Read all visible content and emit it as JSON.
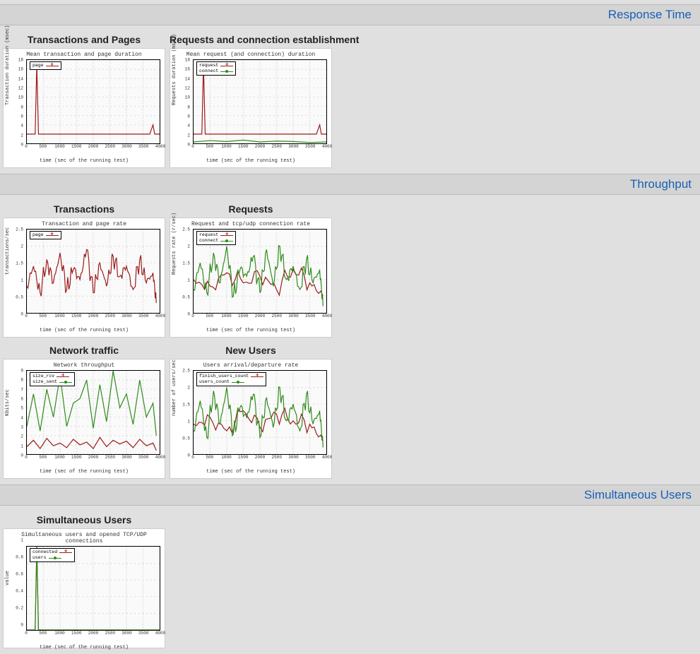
{
  "sections": {
    "response_time": "Response Time",
    "throughput": "Throughput",
    "simultaneous": "Simultaneous Users"
  },
  "xlabel_common": "time (sec of the running test)",
  "xticks": [
    "0",
    "500",
    "1000",
    "1500",
    "2000",
    "2500",
    "3000",
    "3500",
    "4000"
  ],
  "charts": {
    "txn_pages": {
      "title": "Transactions and Pages",
      "subtitle": "Mean transaction and page duration",
      "ylabel": "Transaction duration (msec)",
      "legend": [
        {
          "name": "page",
          "color": "red",
          "marker": "cross"
        }
      ],
      "ylim": [
        0,
        18
      ],
      "yticks": [
        "0",
        "2",
        "4",
        "6",
        "8",
        "10",
        "12",
        "14",
        "16",
        "18"
      ]
    },
    "req_conn": {
      "title": "Requests and connection establishment",
      "subtitle": "Mean request (and connection) duration",
      "ylabel": "Requests duration (msec)",
      "legend": [
        {
          "name": "request",
          "color": "red",
          "marker": "cross"
        },
        {
          "name": "connect",
          "color": "green",
          "marker": "dot"
        }
      ],
      "ylim": [
        0,
        18
      ],
      "yticks": [
        "0",
        "2",
        "4",
        "6",
        "8",
        "10",
        "12",
        "14",
        "16",
        "18"
      ]
    },
    "txn_rate": {
      "title": "Transactions",
      "subtitle": "Transaction and page rate",
      "ylabel": "transactions/sec",
      "legend": [
        {
          "name": "page",
          "color": "red",
          "marker": "cross"
        }
      ],
      "ylim": [
        0,
        2.5
      ],
      "yticks": [
        "0",
        "0.5",
        "1",
        "1.5",
        "2",
        "2.5"
      ]
    },
    "req_rate": {
      "title": "Requests",
      "subtitle": "Request and tcp/udp connection rate",
      "ylabel": "Requests rate (r/sec)",
      "legend": [
        {
          "name": "request",
          "color": "red",
          "marker": "cross"
        },
        {
          "name": "connect",
          "color": "green",
          "marker": "dot"
        }
      ],
      "ylim": [
        0,
        2.5
      ],
      "yticks": [
        "0",
        "0.5",
        "1",
        "1.5",
        "2",
        "2.5"
      ]
    },
    "network": {
      "title": "Network traffic",
      "subtitle": "Network throughput",
      "ylabel": "Kbits/sec",
      "legend": [
        {
          "name": "size_rcv",
          "color": "red",
          "marker": "cross"
        },
        {
          "name": "size_sent",
          "color": "green",
          "marker": "dot"
        }
      ],
      "ylim": [
        0,
        9
      ],
      "yticks": [
        "0",
        "1",
        "2",
        "3",
        "4",
        "5",
        "6",
        "7",
        "8",
        "9"
      ]
    },
    "new_users": {
      "title": "New Users",
      "subtitle": "Users arrival/departure rate",
      "ylabel": "number of users/sec",
      "legend": [
        {
          "name": "finish_users_count",
          "color": "red",
          "marker": "cross"
        },
        {
          "name": "users_count",
          "color": "green",
          "marker": "dot"
        }
      ],
      "ylim": [
        0,
        2.5
      ],
      "yticks": [
        "0",
        "0.5",
        "1",
        "1.5",
        "2",
        "2.5"
      ]
    },
    "sim_users": {
      "title": "Simultaneous Users",
      "subtitle": "Simultaneous users and opened TCP/UDP connections",
      "ylabel": "value",
      "legend": [
        {
          "name": "connected",
          "color": "red",
          "marker": "cross"
        },
        {
          "name": "users",
          "color": "green",
          "marker": "dot"
        }
      ],
      "ylim": [
        0,
        1
      ],
      "yticks": [
        "0",
        "0.2",
        "0.4",
        "0.6",
        "0.8",
        "1"
      ]
    }
  },
  "chart_data": [
    {
      "id": "txn_pages",
      "type": "line",
      "xlabel": "time (sec of the running test)",
      "ylabel": "Transaction duration (msec)",
      "title": "Mean transaction and page duration",
      "xlim": [
        0,
        4000
      ],
      "ylim": [
        0,
        18
      ],
      "series": [
        {
          "name": "page",
          "color": "#9c1b1b",
          "approx": "nearly flat around 2 with spike to ~17 near x≈300 and small bump to ~4 near x≈3800",
          "x": [
            0,
            250,
            300,
            350,
            1000,
            2000,
            2500,
            3000,
            3500,
            3700,
            3800,
            3850,
            4000
          ],
          "y": [
            2,
            2,
            17,
            2,
            2,
            2,
            2,
            2,
            2,
            2,
            4,
            2,
            2
          ]
        }
      ]
    },
    {
      "id": "req_conn",
      "type": "line",
      "xlabel": "time (sec of the running test)",
      "ylabel": "Requests duration (msec)",
      "title": "Mean request (and connection) duration",
      "xlim": [
        0,
        4000
      ],
      "ylim": [
        0,
        18
      ],
      "series": [
        {
          "name": "request",
          "color": "#9c1b1b",
          "approx": "~2 baseline, spike to ~17 at x≈300, bump to ~4 at x≈3800",
          "x": [
            0,
            250,
            300,
            350,
            1000,
            2000,
            3000,
            3700,
            3800,
            3850,
            4000
          ],
          "y": [
            2,
            2,
            17,
            2,
            2,
            2,
            2,
            2,
            4,
            2,
            2
          ]
        },
        {
          "name": "connect",
          "color": "#2e8b1a",
          "approx": "low noisy baseline ~0–1",
          "x": [
            0,
            500,
            1000,
            1500,
            2000,
            2500,
            3000,
            3500,
            4000
          ],
          "y": [
            0.3,
            0.6,
            0.4,
            0.7,
            0.3,
            0.5,
            0.4,
            0.2,
            0.3
          ]
        }
      ]
    },
    {
      "id": "txn_rate",
      "type": "line",
      "xlabel": "time (sec of the running test)",
      "ylabel": "transactions/sec",
      "title": "Transaction and page rate",
      "xlim": [
        0,
        4000
      ],
      "ylim": [
        0,
        2.5
      ],
      "series": [
        {
          "name": "page",
          "color": "#9c1b1b",
          "approx": "dense noise oscillating roughly 0.5–1.5 with occasional peaks near 2",
          "x": [
            0,
            200,
            400,
            600,
            800,
            1000,
            1200,
            1400,
            1600,
            1800,
            2000,
            2200,
            2400,
            2600,
            2800,
            3000,
            3200,
            3400,
            3600,
            3800,
            3900
          ],
          "y": [
            0.8,
            1.4,
            0.6,
            1.6,
            0.9,
            1.8,
            0.7,
            1.3,
            1.0,
            1.9,
            0.6,
            1.5,
            0.8,
            1.7,
            1.1,
            1.4,
            0.7,
            1.6,
            0.9,
            1.2,
            0.3
          ]
        }
      ]
    },
    {
      "id": "req_rate",
      "type": "line",
      "xlabel": "time (sec of the running test)",
      "ylabel": "Requests rate (r/sec)",
      "title": "Request and tcp/udp connection rate",
      "xlim": [
        0,
        4000
      ],
      "ylim": [
        0,
        2.5
      ],
      "series": [
        {
          "name": "request",
          "color": "#9c1b1b",
          "approx": "mostly hidden behind connect, noise 0.5–1.5",
          "x": [
            0,
            500,
            1000,
            1500,
            2000,
            2500,
            3000,
            3500,
            3900
          ],
          "y": [
            1.0,
            0.8,
            1.2,
            0.9,
            1.1,
            0.7,
            1.3,
            0.9,
            0.5
          ]
        },
        {
          "name": "connect",
          "color": "#2e8b1a",
          "approx": "dense green noise 0.3–2.0",
          "x": [
            0,
            200,
            400,
            600,
            800,
            1000,
            1200,
            1400,
            1600,
            1800,
            2000,
            2200,
            2400,
            2600,
            2800,
            3000,
            3200,
            3400,
            3600,
            3800,
            3900
          ],
          "y": [
            0.7,
            1.5,
            0.6,
            1.8,
            0.9,
            2.0,
            0.5,
            1.3,
            1.1,
            1.7,
            0.6,
            1.9,
            0.8,
            2.0,
            1.0,
            1.4,
            0.7,
            1.6,
            0.9,
            1.3,
            0.2
          ]
        }
      ]
    },
    {
      "id": "network",
      "type": "line",
      "xlabel": "time (sec of the running test)",
      "ylabel": "Kbits/sec",
      "title": "Network throughput",
      "xlim": [
        0,
        4000
      ],
      "ylim": [
        0,
        9
      ],
      "series": [
        {
          "name": "size_rcv",
          "color": "#9c1b1b",
          "approx": "noisy low band roughly 0.5–2",
          "x": [
            0,
            200,
            400,
            600,
            800,
            1000,
            1200,
            1400,
            1600,
            1800,
            2000,
            2200,
            2400,
            2600,
            2800,
            3000,
            3200,
            3400,
            3600,
            3800,
            3900
          ],
          "y": [
            0.8,
            1.5,
            0.6,
            1.7,
            0.9,
            1.2,
            0.7,
            1.6,
            1.0,
            1.3,
            0.6,
            1.8,
            0.8,
            1.5,
            1.1,
            1.4,
            0.7,
            1.6,
            0.9,
            1.2,
            0.4
          ]
        },
        {
          "name": "size_sent",
          "color": "#2e8b1a",
          "approx": "noisy high band roughly 2–8 with spikes near 9",
          "x": [
            0,
            200,
            400,
            600,
            800,
            1000,
            1200,
            1400,
            1600,
            1800,
            2000,
            2200,
            2400,
            2600,
            2800,
            3000,
            3200,
            3400,
            3600,
            3800,
            3900
          ],
          "y": [
            3.0,
            6.5,
            2.5,
            7.0,
            4.0,
            8.5,
            3.0,
            5.5,
            6.0,
            8.0,
            2.8,
            7.5,
            3.5,
            9.0,
            5.0,
            6.5,
            3.2,
            8.0,
            4.0,
            5.5,
            2.0
          ]
        }
      ]
    },
    {
      "id": "new_users",
      "type": "line",
      "xlabel": "time (sec of the running test)",
      "ylabel": "number of users/sec",
      "title": "Users arrival/departure rate",
      "xlim": [
        0,
        4000
      ],
      "ylim": [
        0,
        2.5
      ],
      "series": [
        {
          "name": "finish_users_count",
          "color": "#9c1b1b",
          "approx": "mostly hidden behind green, ~0.5–1.5 noise",
          "x": [
            0,
            500,
            1000,
            1500,
            2000,
            2500,
            3000,
            3500,
            3900
          ],
          "y": [
            0.9,
            1.1,
            0.7,
            1.3,
            0.8,
            1.2,
            1.0,
            0.9,
            0.4
          ]
        },
        {
          "name": "users_count",
          "color": "#2e8b1a",
          "approx": "dense noise 0.3–2.0",
          "x": [
            0,
            200,
            400,
            600,
            800,
            1000,
            1200,
            1400,
            1600,
            1800,
            2000,
            2200,
            2400,
            2600,
            2800,
            3000,
            3200,
            3400,
            3600,
            3800,
            3900
          ],
          "y": [
            0.7,
            1.6,
            0.5,
            1.9,
            0.9,
            2.0,
            0.6,
            1.4,
            1.1,
            1.8,
            0.5,
            1.7,
            0.8,
            2.0,
            1.0,
            1.5,
            0.7,
            1.8,
            0.9,
            1.3,
            0.2
          ]
        }
      ]
    },
    {
      "id": "sim_users",
      "type": "line",
      "xlabel": "time (sec of the running test)",
      "ylabel": "value",
      "title": "Simultaneous users and opened TCP/UDP connections",
      "xlim": [
        0,
        4000
      ],
      "ylim": [
        0,
        1
      ],
      "series": [
        {
          "name": "connected",
          "color": "#9c1b1b",
          "approx": "flat at 0 except single spike to 1 near x≈300",
          "x": [
            0,
            250,
            300,
            350,
            4000
          ],
          "y": [
            0,
            0,
            1,
            0,
            0
          ]
        },
        {
          "name": "users",
          "color": "#2e8b1a",
          "approx": "flat at 0 except single spike to 1 near x≈300",
          "x": [
            0,
            250,
            300,
            350,
            4000
          ],
          "y": [
            0,
            0,
            1,
            0,
            0
          ]
        }
      ]
    }
  ]
}
